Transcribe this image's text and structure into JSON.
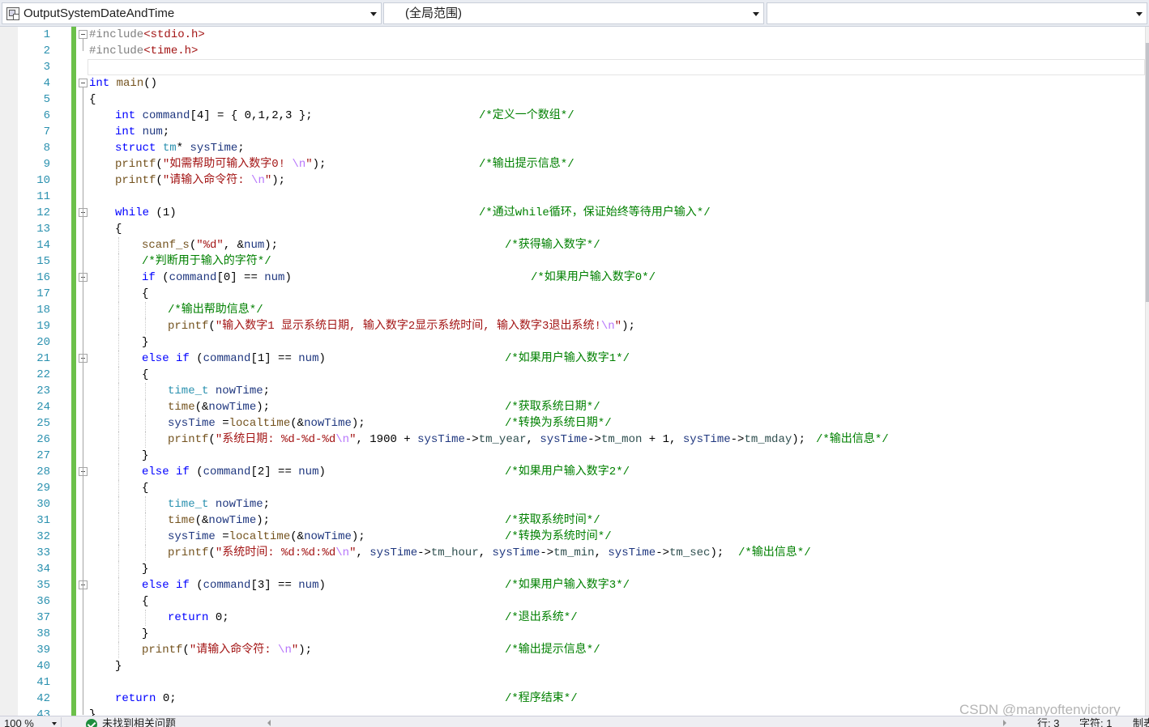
{
  "navbar": {
    "project": "OutputSystemDateAndTime",
    "scope": "(全局范围)",
    "member": ""
  },
  "lines": [
    {
      "n": "1",
      "fold": true,
      "indent": 0,
      "code": [
        [
          "pp",
          "#include"
        ],
        [
          "s",
          "<stdio.h>"
        ]
      ]
    },
    {
      "n": "2",
      "indent": 0,
      "code": [
        [
          "pp",
          "#include"
        ],
        [
          "s",
          "<time.h>"
        ]
      ]
    },
    {
      "n": "3",
      "indent": 0,
      "code": []
    },
    {
      "n": "4",
      "fold": true,
      "indent": 0,
      "code": [
        [
          "k",
          "int"
        ],
        [
          "p",
          " "
        ],
        [
          "f",
          "main"
        ],
        [
          "p",
          "()"
        ]
      ]
    },
    {
      "n": "5",
      "indent": 0,
      "code": [
        [
          "p",
          "{"
        ]
      ]
    },
    {
      "n": "6",
      "indent": 1,
      "code": [
        [
          "k",
          "int"
        ],
        [
          "p",
          " "
        ],
        [
          "v",
          "command"
        ],
        [
          "p",
          "[4] = { 0,1,2,3 };"
        ]
      ],
      "comment": "/*定义一个数组*/",
      "cpos": "a"
    },
    {
      "n": "7",
      "indent": 1,
      "code": [
        [
          "k",
          "int"
        ],
        [
          "p",
          " "
        ],
        [
          "v",
          "num"
        ],
        [
          "p",
          ";"
        ]
      ]
    },
    {
      "n": "8",
      "indent": 1,
      "code": [
        [
          "k",
          "struct"
        ],
        [
          "p",
          " "
        ],
        [
          "t",
          "tm"
        ],
        [
          "p",
          "* "
        ],
        [
          "v",
          "sysTime"
        ],
        [
          "p",
          ";"
        ]
      ]
    },
    {
      "n": "9",
      "indent": 1,
      "code": [
        [
          "f",
          "printf"
        ],
        [
          "p",
          "("
        ],
        [
          "s",
          "\"如需帮助可输入数字0! "
        ],
        [
          "e",
          "\\n"
        ],
        [
          "s",
          "\""
        ],
        [
          "p",
          ");"
        ]
      ],
      "comment": "/*输出提示信息*/",
      "cpos": "a"
    },
    {
      "n": "10",
      "indent": 1,
      "code": [
        [
          "f",
          "printf"
        ],
        [
          "p",
          "("
        ],
        [
          "s",
          "\"请输入命令符: "
        ],
        [
          "e",
          "\\n"
        ],
        [
          "s",
          "\""
        ],
        [
          "p",
          ");"
        ]
      ]
    },
    {
      "n": "11",
      "indent": 0,
      "code": []
    },
    {
      "n": "12",
      "fold": true,
      "indent": 1,
      "code": [
        [
          "k",
          "while"
        ],
        [
          "p",
          " (1)"
        ]
      ],
      "comment": "/*通过while循环，保证始终等待用户输入*/",
      "cpos": "a"
    },
    {
      "n": "13",
      "indent": 1,
      "code": [
        [
          "p",
          "{"
        ]
      ]
    },
    {
      "n": "14",
      "indent": 2,
      "code": [
        [
          "f",
          "scanf_s"
        ],
        [
          "p",
          "("
        ],
        [
          "s",
          "\"%d\""
        ],
        [
          "p",
          ", &"
        ],
        [
          "v",
          "num"
        ],
        [
          "p",
          ");"
        ]
      ],
      "comment": "/*获得输入数字*/",
      "cpos": "b"
    },
    {
      "n": "15",
      "indent": 2,
      "code": [],
      "comment": "/*判断用于输入的字符*/",
      "cpos": "inline"
    },
    {
      "n": "16",
      "fold": true,
      "indent": 2,
      "code": [
        [
          "k",
          "if"
        ],
        [
          "p",
          " ("
        ],
        [
          "v",
          "command"
        ],
        [
          "p",
          "[0] == "
        ],
        [
          "v",
          "num"
        ],
        [
          "p",
          ")"
        ]
      ],
      "comment": "/*如果用户输入数字0*/",
      "cpos": "c"
    },
    {
      "n": "17",
      "indent": 2,
      "code": [
        [
          "p",
          "{"
        ]
      ]
    },
    {
      "n": "18",
      "indent": 3,
      "code": [],
      "comment": "/*输出帮助信息*/",
      "cpos": "inline"
    },
    {
      "n": "19",
      "indent": 3,
      "code": [
        [
          "f",
          "printf"
        ],
        [
          "p",
          "("
        ],
        [
          "s",
          "\"输入数字1 显示系统日期, 输入数字2显示系统时间, 输入数字3退出系统!"
        ],
        [
          "e",
          "\\n"
        ],
        [
          "s",
          "\""
        ],
        [
          "p",
          ");"
        ]
      ]
    },
    {
      "n": "20",
      "indent": 2,
      "code": [
        [
          "p",
          "}"
        ]
      ]
    },
    {
      "n": "21",
      "fold": true,
      "indent": 2,
      "code": [
        [
          "k",
          "else"
        ],
        [
          "p",
          " "
        ],
        [
          "k",
          "if"
        ],
        [
          "p",
          " ("
        ],
        [
          "v",
          "command"
        ],
        [
          "p",
          "[1] == "
        ],
        [
          "v",
          "num"
        ],
        [
          "p",
          ")"
        ]
      ],
      "comment": "/*如果用户输入数字1*/",
      "cpos": "b"
    },
    {
      "n": "22",
      "indent": 2,
      "code": [
        [
          "p",
          "{"
        ]
      ]
    },
    {
      "n": "23",
      "indent": 3,
      "code": [
        [
          "t",
          "time_t"
        ],
        [
          "p",
          " "
        ],
        [
          "v",
          "nowTime"
        ],
        [
          "p",
          ";"
        ]
      ]
    },
    {
      "n": "24",
      "indent": 3,
      "code": [
        [
          "f",
          "time"
        ],
        [
          "p",
          "(&"
        ],
        [
          "v",
          "nowTime"
        ],
        [
          "p",
          ");"
        ]
      ],
      "comment": "/*获取系统日期*/",
      "cpos": "b"
    },
    {
      "n": "25",
      "indent": 3,
      "code": [
        [
          "v",
          "sysTime"
        ],
        [
          "p",
          " ="
        ],
        [
          "f",
          "localtime"
        ],
        [
          "p",
          "(&"
        ],
        [
          "v",
          "nowTime"
        ],
        [
          "p",
          ");"
        ]
      ],
      "comment": "/*转换为系统日期*/",
      "cpos": "b"
    },
    {
      "n": "26",
      "indent": 3,
      "code": [
        [
          "f",
          "printf"
        ],
        [
          "p",
          "("
        ],
        [
          "s",
          "\"系统日期: %d-%d-%d"
        ],
        [
          "e",
          "\\n"
        ],
        [
          "s",
          "\""
        ],
        [
          "p",
          ", 1900 + "
        ],
        [
          "v",
          "sysTime"
        ],
        [
          "p",
          "->"
        ],
        [
          "m",
          "tm_year"
        ],
        [
          "p",
          ", "
        ],
        [
          "v",
          "sysTime"
        ],
        [
          "p",
          "->"
        ],
        [
          "m",
          "tm_mon"
        ],
        [
          "p",
          " + 1, "
        ],
        [
          "v",
          "sysTime"
        ],
        [
          "p",
          "->"
        ],
        [
          "m",
          "tm_mday"
        ],
        [
          "p",
          ");"
        ]
      ],
      "comment": "/*输出信息*/",
      "cpos": "d"
    },
    {
      "n": "27",
      "indent": 2,
      "code": [
        [
          "p",
          "}"
        ]
      ]
    },
    {
      "n": "28",
      "fold": true,
      "indent": 2,
      "code": [
        [
          "k",
          "else"
        ],
        [
          "p",
          " "
        ],
        [
          "k",
          "if"
        ],
        [
          "p",
          " ("
        ],
        [
          "v",
          "command"
        ],
        [
          "p",
          "[2] == "
        ],
        [
          "v",
          "num"
        ],
        [
          "p",
          ")"
        ]
      ],
      "comment": "/*如果用户输入数字2*/",
      "cpos": "b"
    },
    {
      "n": "29",
      "indent": 2,
      "code": [
        [
          "p",
          "{"
        ]
      ]
    },
    {
      "n": "30",
      "indent": 3,
      "code": [
        [
          "t",
          "time_t"
        ],
        [
          "p",
          " "
        ],
        [
          "v",
          "nowTime"
        ],
        [
          "p",
          ";"
        ]
      ]
    },
    {
      "n": "31",
      "indent": 3,
      "code": [
        [
          "f",
          "time"
        ],
        [
          "p",
          "(&"
        ],
        [
          "v",
          "nowTime"
        ],
        [
          "p",
          ");"
        ]
      ],
      "comment": "/*获取系统时间*/",
      "cpos": "b"
    },
    {
      "n": "32",
      "indent": 3,
      "code": [
        [
          "v",
          "sysTime"
        ],
        [
          "p",
          " ="
        ],
        [
          "f",
          "localtime"
        ],
        [
          "p",
          "(&"
        ],
        [
          "v",
          "nowTime"
        ],
        [
          "p",
          ");"
        ]
      ],
      "comment": "/*转换为系统时间*/",
      "cpos": "b"
    },
    {
      "n": "33",
      "indent": 3,
      "code": [
        [
          "f",
          "printf"
        ],
        [
          "p",
          "("
        ],
        [
          "s",
          "\"系统时间: %d:%d:%d"
        ],
        [
          "e",
          "\\n"
        ],
        [
          "s",
          "\""
        ],
        [
          "p",
          ", "
        ],
        [
          "v",
          "sysTime"
        ],
        [
          "p",
          "->"
        ],
        [
          "m",
          "tm_hour"
        ],
        [
          "p",
          ", "
        ],
        [
          "v",
          "sysTime"
        ],
        [
          "p",
          "->"
        ],
        [
          "m",
          "tm_min"
        ],
        [
          "p",
          ", "
        ],
        [
          "v",
          "sysTime"
        ],
        [
          "p",
          "->"
        ],
        [
          "m",
          "tm_sec"
        ],
        [
          "p",
          ");"
        ]
      ],
      "comment": "/*输出信息*/",
      "cpos": "e"
    },
    {
      "n": "34",
      "indent": 2,
      "code": [
        [
          "p",
          "}"
        ]
      ]
    },
    {
      "n": "35",
      "fold": true,
      "indent": 2,
      "code": [
        [
          "k",
          "else"
        ],
        [
          "p",
          " "
        ],
        [
          "k",
          "if"
        ],
        [
          "p",
          " ("
        ],
        [
          "v",
          "command"
        ],
        [
          "p",
          "[3] == "
        ],
        [
          "v",
          "num"
        ],
        [
          "p",
          ")"
        ]
      ],
      "comment": "/*如果用户输入数字3*/",
      "cpos": "b"
    },
    {
      "n": "36",
      "indent": 2,
      "code": [
        [
          "p",
          "{"
        ]
      ]
    },
    {
      "n": "37",
      "indent": 3,
      "code": [
        [
          "k",
          "return"
        ],
        [
          "p",
          " 0;"
        ]
      ],
      "comment": "/*退出系统*/",
      "cpos": "b"
    },
    {
      "n": "38",
      "indent": 2,
      "code": [
        [
          "p",
          "}"
        ]
      ]
    },
    {
      "n": "39",
      "indent": 2,
      "code": [
        [
          "f",
          "printf"
        ],
        [
          "p",
          "("
        ],
        [
          "s",
          "\"请输入命令符: "
        ],
        [
          "e",
          "\\n"
        ],
        [
          "s",
          "\""
        ],
        [
          "p",
          ");"
        ]
      ],
      "comment": "/*输出提示信息*/",
      "cpos": "b"
    },
    {
      "n": "40",
      "indent": 1,
      "code": [
        [
          "p",
          "}"
        ]
      ]
    },
    {
      "n": "41",
      "indent": 0,
      "code": []
    },
    {
      "n": "42",
      "indent": 1,
      "code": [
        [
          "k",
          "return"
        ],
        [
          "p",
          " 0;"
        ]
      ],
      "comment": "/*程序结束*/",
      "cpos": "b"
    },
    {
      "n": "43",
      "indent": 0,
      "code": [
        [
          "p",
          "}"
        ]
      ]
    }
  ],
  "watermark": "CSDN @manyoftenvictory",
  "status": {
    "zoom": "100 %",
    "issues": "未找到相关问题",
    "row": "行: 3",
    "col": "字符: 1",
    "tab": "制表符"
  }
}
